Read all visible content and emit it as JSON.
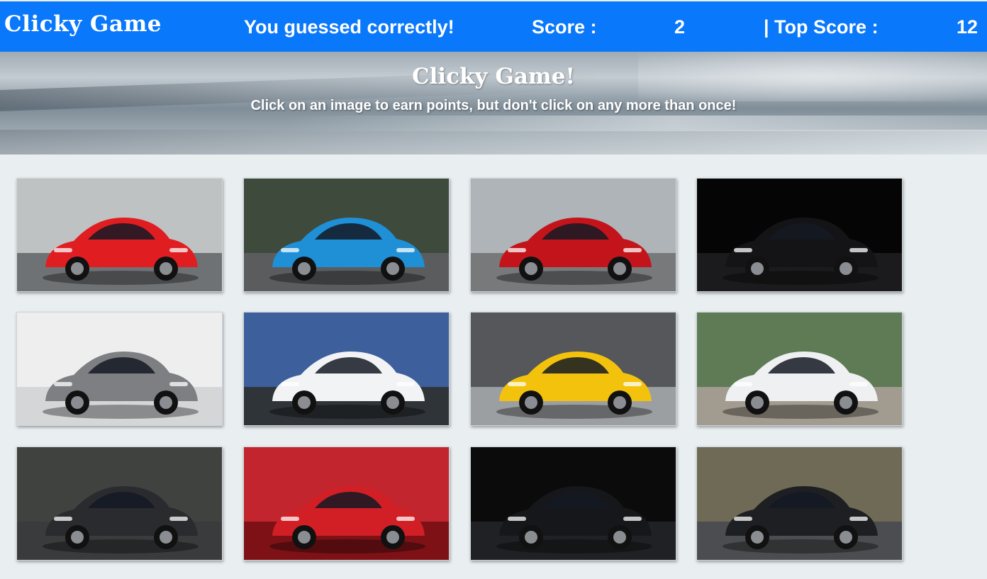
{
  "navbar": {
    "brand": "Clicky Game",
    "message": "You guessed correctly!",
    "score_label": "Score :",
    "score": "2",
    "top_score_label": "| Top Score :",
    "top_score": "12",
    "color": "#0a78fb"
  },
  "header": {
    "title": "Clicky Game!",
    "subtitle": "Click on an image to earn points, but don't click on any more than once!"
  },
  "cards": [
    {
      "icon": "red-ferrari-laferrari-image",
      "body": "#e01e22",
      "bg": "#bfc2c3",
      "ground": "#6f7274"
    },
    {
      "icon": "blue-bugatti-chiron-image",
      "body": "#1f8fd6",
      "bg": "#3d4a3c",
      "ground": "#5b5c5e"
    },
    {
      "icon": "red-ferrari-488-pista-image",
      "body": "#c3141b",
      "bg": "#aeb4b8",
      "ground": "#77797b"
    },
    {
      "icon": "black-bugatti-la-voiture-noire-image",
      "body": "#141416",
      "bg": "#050506",
      "ground": "#1b1b1d"
    },
    {
      "icon": "silver-bentley-concept-image",
      "body": "#7d7f82",
      "bg": "#eeeeee",
      "ground": "#d5d6d7"
    },
    {
      "icon": "white-mercedes-biome-palm-image",
      "body": "#f2f3f5",
      "bg": "#3d5f9c",
      "ground": "#2f3438"
    },
    {
      "icon": "yellow-ferrari-image",
      "body": "#f2c20d",
      "bg": "#55575a",
      "ground": "#9c9fa2"
    },
    {
      "icon": "white-mercedes-biome-image",
      "body": "#eef0f2",
      "bg": "#5e7b55",
      "ground": "#a29b90"
    },
    {
      "icon": "black-bugatti-chiron-sport-image",
      "body": "#2a2b2e",
      "bg": "#3f423f",
      "ground": "#3a3b3d"
    },
    {
      "icon": "red-ferrari-concept-image",
      "body": "#d21f26",
      "bg": "#c2252e",
      "ground": "#7e1116"
    },
    {
      "icon": "black-lamborghini-egoista-image",
      "body": "#16171a",
      "bg": "#0b0b0c",
      "ground": "#202124"
    },
    {
      "icon": "black-bugatti-chiron-road-image",
      "body": "#1e1f22",
      "bg": "#6f6a55",
      "ground": "#4c4d50"
    }
  ]
}
